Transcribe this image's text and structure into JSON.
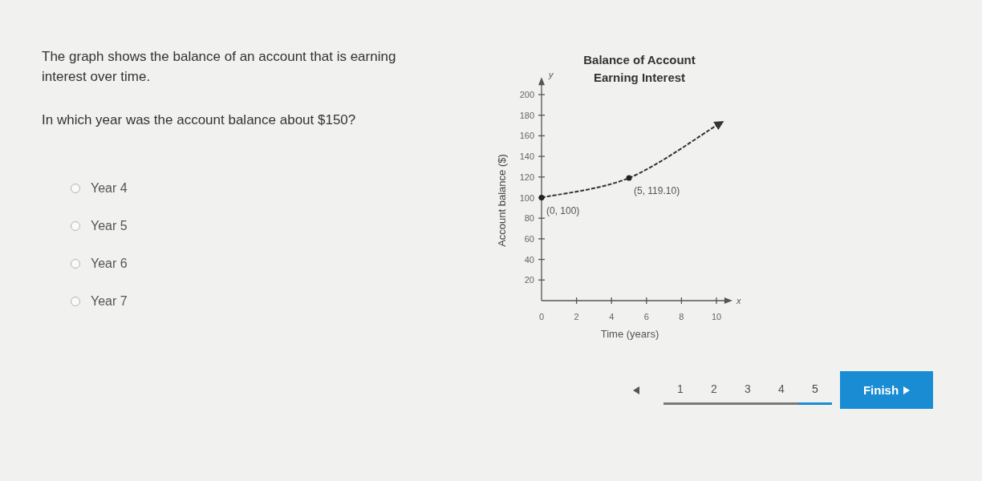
{
  "question": {
    "prompt": "The graph shows the balance of an account that is earning interest over time.",
    "text": "In which year was the account balance about $150?"
  },
  "options": [
    {
      "label": "Year 4",
      "selected": false
    },
    {
      "label": "Year 5",
      "selected": false
    },
    {
      "label": "Year 6",
      "selected": false
    },
    {
      "label": "Year 7",
      "selected": false
    }
  ],
  "chart": {
    "axis_letters": {
      "x": "x",
      "y": "y"
    },
    "chart_data": {
      "type": "line",
      "title": "Balance of Account Earning Interest",
      "xlabel": "Time (years)",
      "ylabel": "Account balance ($)",
      "x": [
        0,
        5,
        10
      ],
      "values": [
        100,
        119.1,
        170
      ],
      "line_style": "dashed",
      "xlim": [
        0,
        10.5
      ],
      "ylim": [
        0,
        210
      ],
      "xticks": [
        0,
        2,
        4,
        6,
        8,
        10
      ],
      "yticks": [
        20,
        40,
        60,
        80,
        100,
        120,
        140,
        160,
        180,
        200
      ],
      "annotations": [
        {
          "x": 0,
          "y": 100,
          "text": "(0, 100)"
        },
        {
          "x": 5,
          "y": 119.1,
          "text": "(5, 119.10)"
        }
      ]
    }
  },
  "pager": {
    "pages": [
      {
        "label": "1",
        "selected": false
      },
      {
        "label": "2",
        "selected": false
      },
      {
        "label": "3",
        "selected": false
      },
      {
        "label": "4",
        "selected": false
      },
      {
        "label": "5",
        "selected": true
      }
    ]
  },
  "finish_button": {
    "label": "Finish"
  }
}
